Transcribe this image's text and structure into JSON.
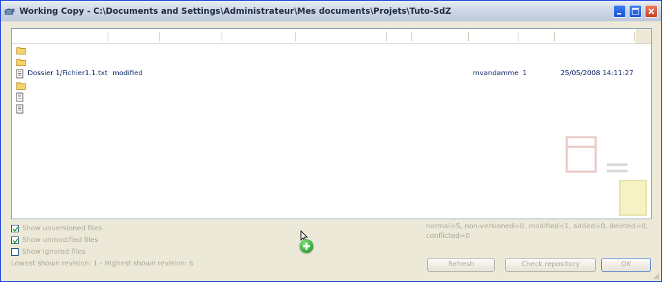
{
  "window": {
    "title": "Working Copy - C:\\Documents and Settings\\Administrateur\\Mes documents\\Projets\\Tuto-SdZ",
    "icons": {
      "app": "tortoise-app-icon",
      "minimize": "minimize-icon",
      "maximize": "maximize-icon",
      "close": "close-icon"
    }
  },
  "list": {
    "rows": [
      {
        "type": "folder",
        "path": "",
        "status": "",
        "author": "",
        "revision": "",
        "date": ""
      },
      {
        "type": "folder",
        "path": "",
        "status": "",
        "author": "",
        "revision": "",
        "date": ""
      },
      {
        "type": "file",
        "path": "Dossier 1/Fichier1.1.txt",
        "status": "modified",
        "author": "mvandamme",
        "revision": "1",
        "date": "25/05/2008 14:11:27"
      },
      {
        "type": "folder",
        "path": "",
        "status": "",
        "author": "",
        "revision": "",
        "date": ""
      },
      {
        "type": "file",
        "path": "",
        "status": "",
        "author": "",
        "revision": "",
        "date": ""
      },
      {
        "type": "file",
        "path": "",
        "status": "",
        "author": "",
        "revision": "",
        "date": ""
      }
    ]
  },
  "options": {
    "show_unversioned": {
      "label": "Show unversioned files",
      "checked": true
    },
    "show_unmodified": {
      "label": "Show unmodified files",
      "checked": true
    },
    "show_ignored": {
      "label": "Show ignored files",
      "checked": false
    }
  },
  "status_summary": "normal=5, non-versioned=0, modified=1, added=0, deleted=0, conflicted=0",
  "revision_info": "Lowest shown revision: 1 - Highest shown revision: 6",
  "buttons": {
    "refresh": "Refresh",
    "check_repository": "Check repository",
    "ok": "OK"
  },
  "colors": {
    "title_gradient_top": "#e9eef6",
    "text_link": "#0a246a",
    "disabled_text": "#aca899",
    "dialog_bg": "#ece9d8",
    "add_badge": "#1b8a22"
  }
}
